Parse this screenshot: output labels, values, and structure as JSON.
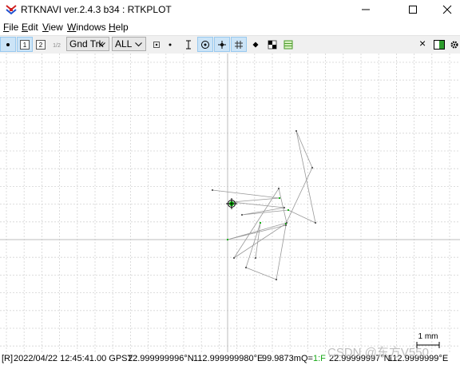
{
  "window": {
    "title": "RTKNAVI ver.2.4.3 b34 : RTKPLOT",
    "icon": "rtk-app-icon",
    "controls": [
      "minimize-icon",
      "maximize-icon",
      "close-icon"
    ]
  },
  "menu": {
    "items": [
      {
        "u": "F",
        "rest": "ile"
      },
      {
        "u": "E",
        "rest": "dit"
      },
      {
        "u": "V",
        "rest": "iew"
      },
      {
        "u": "W",
        "rest": "indows"
      },
      {
        "u": "H",
        "rest": "elp"
      }
    ]
  },
  "toolbar": {
    "btn1_label": "1",
    "btn2_label": "2",
    "btn12_label": "1/2",
    "plot_type": "Gnd Trk",
    "quality": "ALL",
    "close_glyph": "×"
  },
  "plot": {
    "scale_label": "1 mm",
    "grid": true,
    "track_color": "#999999",
    "fix_color": "#00aa00",
    "float_color": "#f0a000",
    "current_marker_color": "#00cc00"
  },
  "status": {
    "prefix": "[R]",
    "time": "2022/04/22 12:45:41.00 GPST :",
    "lat": "22.999999996°N",
    "lon": "112.999999980°E",
    "height": "99.9873m",
    "q_label": "Q=",
    "q_value": "1:F",
    "lat2": "22.99999997°N",
    "lon2": "112.9999999°E"
  },
  "watermark": "CSDN @东方V550"
}
